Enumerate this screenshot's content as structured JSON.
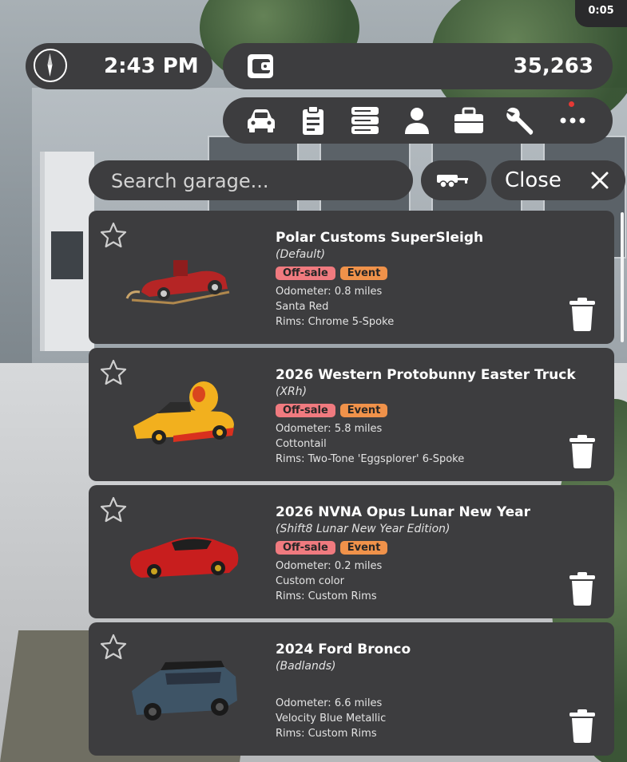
{
  "hud": {
    "timer": "0:05",
    "time": "2:43 PM",
    "money": "35,263",
    "nav_icons": [
      "car-icon",
      "clipboard-icon",
      "server-icon",
      "user-icon",
      "briefcase-icon",
      "wrench-icon",
      "more-icon"
    ]
  },
  "garage": {
    "search_placeholder": "Search garage...",
    "close_label": "Close"
  },
  "cars": [
    {
      "name": "Polar Customs SuperSleigh",
      "variant": "(Default)",
      "badges": [
        "Off-sale",
        "Event"
      ],
      "odometer": "Odometer: 0.8 miles",
      "color": "Santa Red",
      "rims": "Rims: Chrome 5-Spoke"
    },
    {
      "name": "2026 Western Protobunny Easter Truck",
      "variant": "(XRh)",
      "badges": [
        "Off-sale",
        "Event"
      ],
      "odometer": "Odometer: 5.8 miles",
      "color": "Cottontail",
      "rims": "Rims: Two-Tone 'Eggsplorer' 6-Spoke"
    },
    {
      "name": "2026 NVNA Opus Lunar New Year",
      "variant": "(Shift8 Lunar New Year Edition)",
      "badges": [
        "Off-sale",
        "Event"
      ],
      "odometer": "Odometer: 0.2 miles",
      "color": "Custom color",
      "rims": "Rims: Custom Rims"
    },
    {
      "name": "2024 Ford Bronco",
      "variant": "(Badlands)",
      "badges": [],
      "odometer": "Odometer: 6.6 miles",
      "color": "Velocity Blue Metallic",
      "rims": "Rims: Custom Rims"
    }
  ],
  "colors": {
    "panel": "#3d3d3f",
    "offsale_badge": "#f07a7f",
    "event_badge": "#f0924a",
    "notification": "#e53935"
  }
}
